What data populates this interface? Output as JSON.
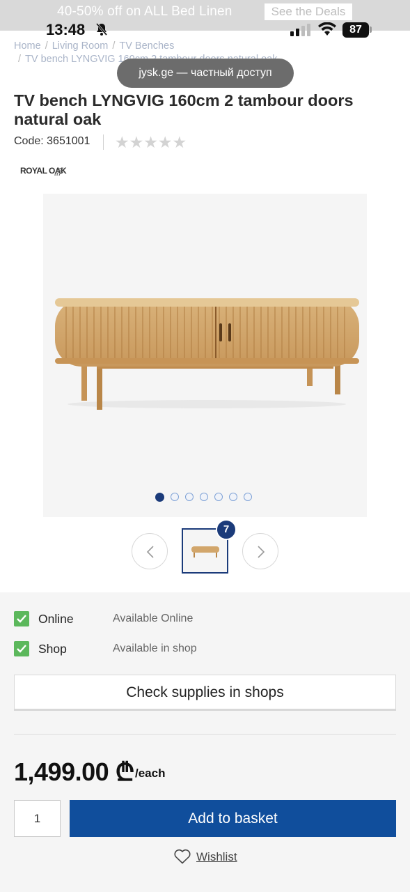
{
  "promo": {
    "text": "40-50% off on ALL Bed Linen",
    "link": "See the Deals"
  },
  "status_bar": {
    "time": "13:48",
    "battery": "87"
  },
  "breadcrumb": {
    "items": [
      "Home",
      "Living Room",
      "TV Benches"
    ],
    "current": "TV bench LYNGVIG 160cm 2 tambour doors natural oak"
  },
  "url_pill": {
    "text": "jysk.ge — частный доступ"
  },
  "product": {
    "title": "TV bench LYNGVIG 160cm 2 tambour doors natural oak",
    "code": "Code: 3651001",
    "rating": 0,
    "stars_max": 5,
    "brand": "ROYAL OAK",
    "image_count": "7",
    "carousel_dots": 7,
    "active_dot": 0
  },
  "availability": [
    {
      "label": "Online",
      "status": "Available Online"
    },
    {
      "label": "Shop",
      "status": "Available in shop"
    }
  ],
  "check_supplies": "Check supplies in shops",
  "price": {
    "amount": "1,499.00",
    "currency": "₾",
    "unit": "/each"
  },
  "quantity": "1",
  "add_to_basket": "Add to basket",
  "wishlist": "Wishlist",
  "colors": {
    "primary": "#104e9c",
    "dark_blue": "#1b3b7a",
    "check_green": "#5cb85c"
  }
}
